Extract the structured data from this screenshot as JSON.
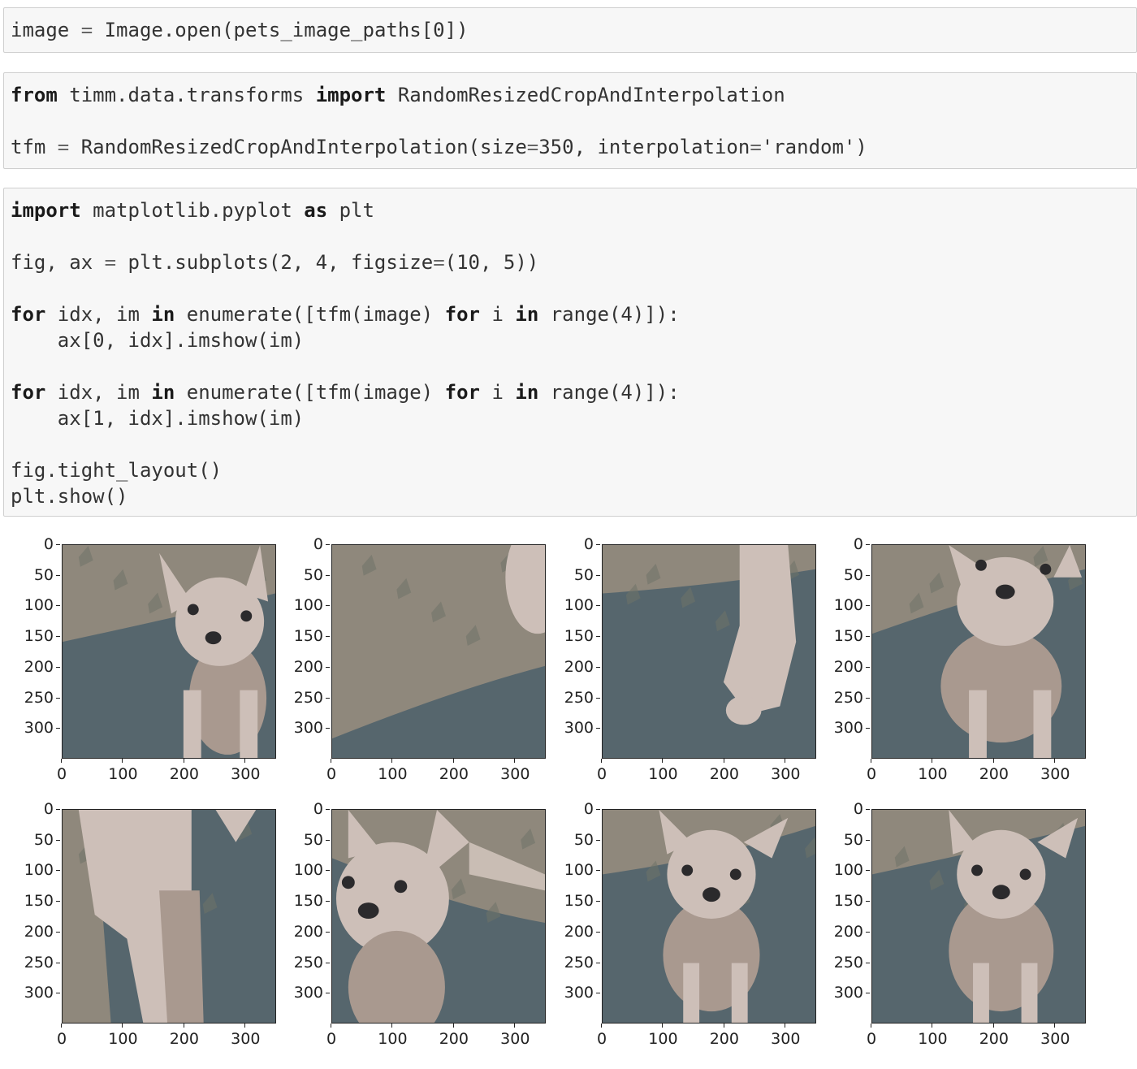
{
  "cells": [
    {
      "lines": [
        [
          [
            "t",
            "image "
          ],
          [
            "op",
            "="
          ],
          [
            "t",
            " Image.open(pets_image_paths[0])"
          ]
        ]
      ]
    },
    {
      "lines": [
        [
          [
            "kw",
            "from"
          ],
          [
            "t",
            " timm.data.transforms "
          ],
          [
            "kw",
            "import"
          ],
          [
            "t",
            " RandomResizedCropAndInterpolation"
          ]
        ],
        [],
        [
          [
            "t",
            "tfm "
          ],
          [
            "op",
            "="
          ],
          [
            "t",
            " RandomResizedCropAndInterpolation(size"
          ],
          [
            "op",
            "="
          ],
          [
            "t",
            "350, interpolation"
          ],
          [
            "op",
            "="
          ],
          [
            "t",
            "'random')"
          ]
        ]
      ]
    },
    {
      "lines": [
        [
          [
            "kw",
            "import"
          ],
          [
            "t",
            " matplotlib.pyplot "
          ],
          [
            "kw",
            "as"
          ],
          [
            "t",
            " plt"
          ]
        ],
        [],
        [
          [
            "t",
            "fig, ax "
          ],
          [
            "op",
            "="
          ],
          [
            "t",
            " plt.subplots(2, 4, figsize"
          ],
          [
            "op",
            "="
          ],
          [
            "t",
            "(10, 5))"
          ]
        ],
        [],
        [
          [
            "kw",
            "for"
          ],
          [
            "t",
            " idx, im "
          ],
          [
            "kw",
            "in"
          ],
          [
            "t",
            " enumerate([tfm(image) "
          ],
          [
            "kw",
            "for"
          ],
          [
            "t",
            " i "
          ],
          [
            "kw",
            "in"
          ],
          [
            "t",
            " range(4)]):"
          ]
        ],
        [
          [
            "t",
            "    ax[0, idx].imshow(im)"
          ]
        ],
        [],
        [
          [
            "kw",
            "for"
          ],
          [
            "t",
            " idx, im "
          ],
          [
            "kw",
            "in"
          ],
          [
            "t",
            " enumerate([tfm(image) "
          ],
          [
            "kw",
            "for"
          ],
          [
            "t",
            " i "
          ],
          [
            "kw",
            "in"
          ],
          [
            "t",
            " range(4)]):"
          ]
        ],
        [
          [
            "t",
            "    ax[1, idx].imshow(im)"
          ]
        ],
        [],
        [
          [
            "t",
            "fig.tight_layout()"
          ]
        ],
        [
          [
            "t",
            "plt.show()"
          ]
        ]
      ]
    }
  ],
  "figure": {
    "rows": 2,
    "cols": 4,
    "yticks": [
      "0",
      "50",
      "100",
      "150",
      "200",
      "250",
      "300"
    ],
    "xticks": [
      "0",
      "100",
      "200",
      "300"
    ],
    "colors": {
      "carpet": "#56666d",
      "wall": "#8f887c",
      "fur": "#cdbfb8",
      "fur_shadow": "#a9998f",
      "eye": "#2b2a2c",
      "bg_light": "#c9bdb4"
    },
    "panels": [
      {
        "subject": "chihuahua puppy close-up, head at right"
      },
      {
        "subject": "mostly patterned wall, ear at top-right"
      },
      {
        "subject": "puppy leg on carpet"
      },
      {
        "subject": "puppy sitting, full front"
      },
      {
        "subject": "close-up of legs"
      },
      {
        "subject": "puppy face, left side"
      },
      {
        "subject": "puppy sitting center"
      },
      {
        "subject": "puppy sitting center-right"
      }
    ]
  }
}
